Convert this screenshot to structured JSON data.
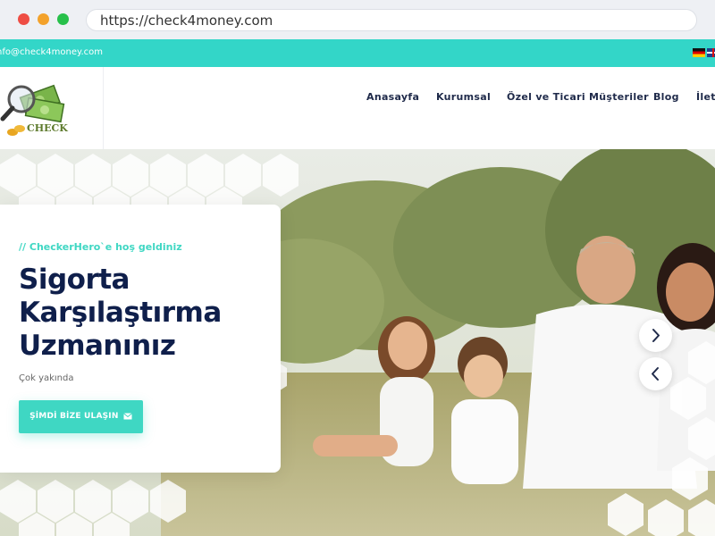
{
  "browser": {
    "url": "https://check4money.com"
  },
  "topbar": {
    "email": "nfo@check4money.com",
    "flags": [
      {
        "icon": "flag-de-icon"
      },
      {
        "icon": "flag-uk-icon"
      }
    ]
  },
  "header": {
    "logo_text": "CHECK",
    "nav": [
      {
        "label": "Anasayfa"
      },
      {
        "label": "Kurumsal"
      },
      {
        "label": "Özel ve Ticari Müşteriler"
      },
      {
        "label": "Blog"
      },
      {
        "label": "İleti"
      }
    ]
  },
  "hero": {
    "tag": "//  CheckerHero`e hoş geldiniz",
    "title": "Sigorta Karşılaştırma Uzmanınız",
    "subtitle": "Çok yakında",
    "cta_label": "ŞİMDİ BİZE ULAŞIN",
    "cta_icon": "envelope-icon",
    "next_icon": "chevron-right-icon",
    "prev_icon": "chevron-left-icon"
  },
  "colors": {
    "accent": "#3fd7c3",
    "topbar": "#33d6c8",
    "heading": "#0f1f4b",
    "nav_text": "#1f2a4a"
  }
}
